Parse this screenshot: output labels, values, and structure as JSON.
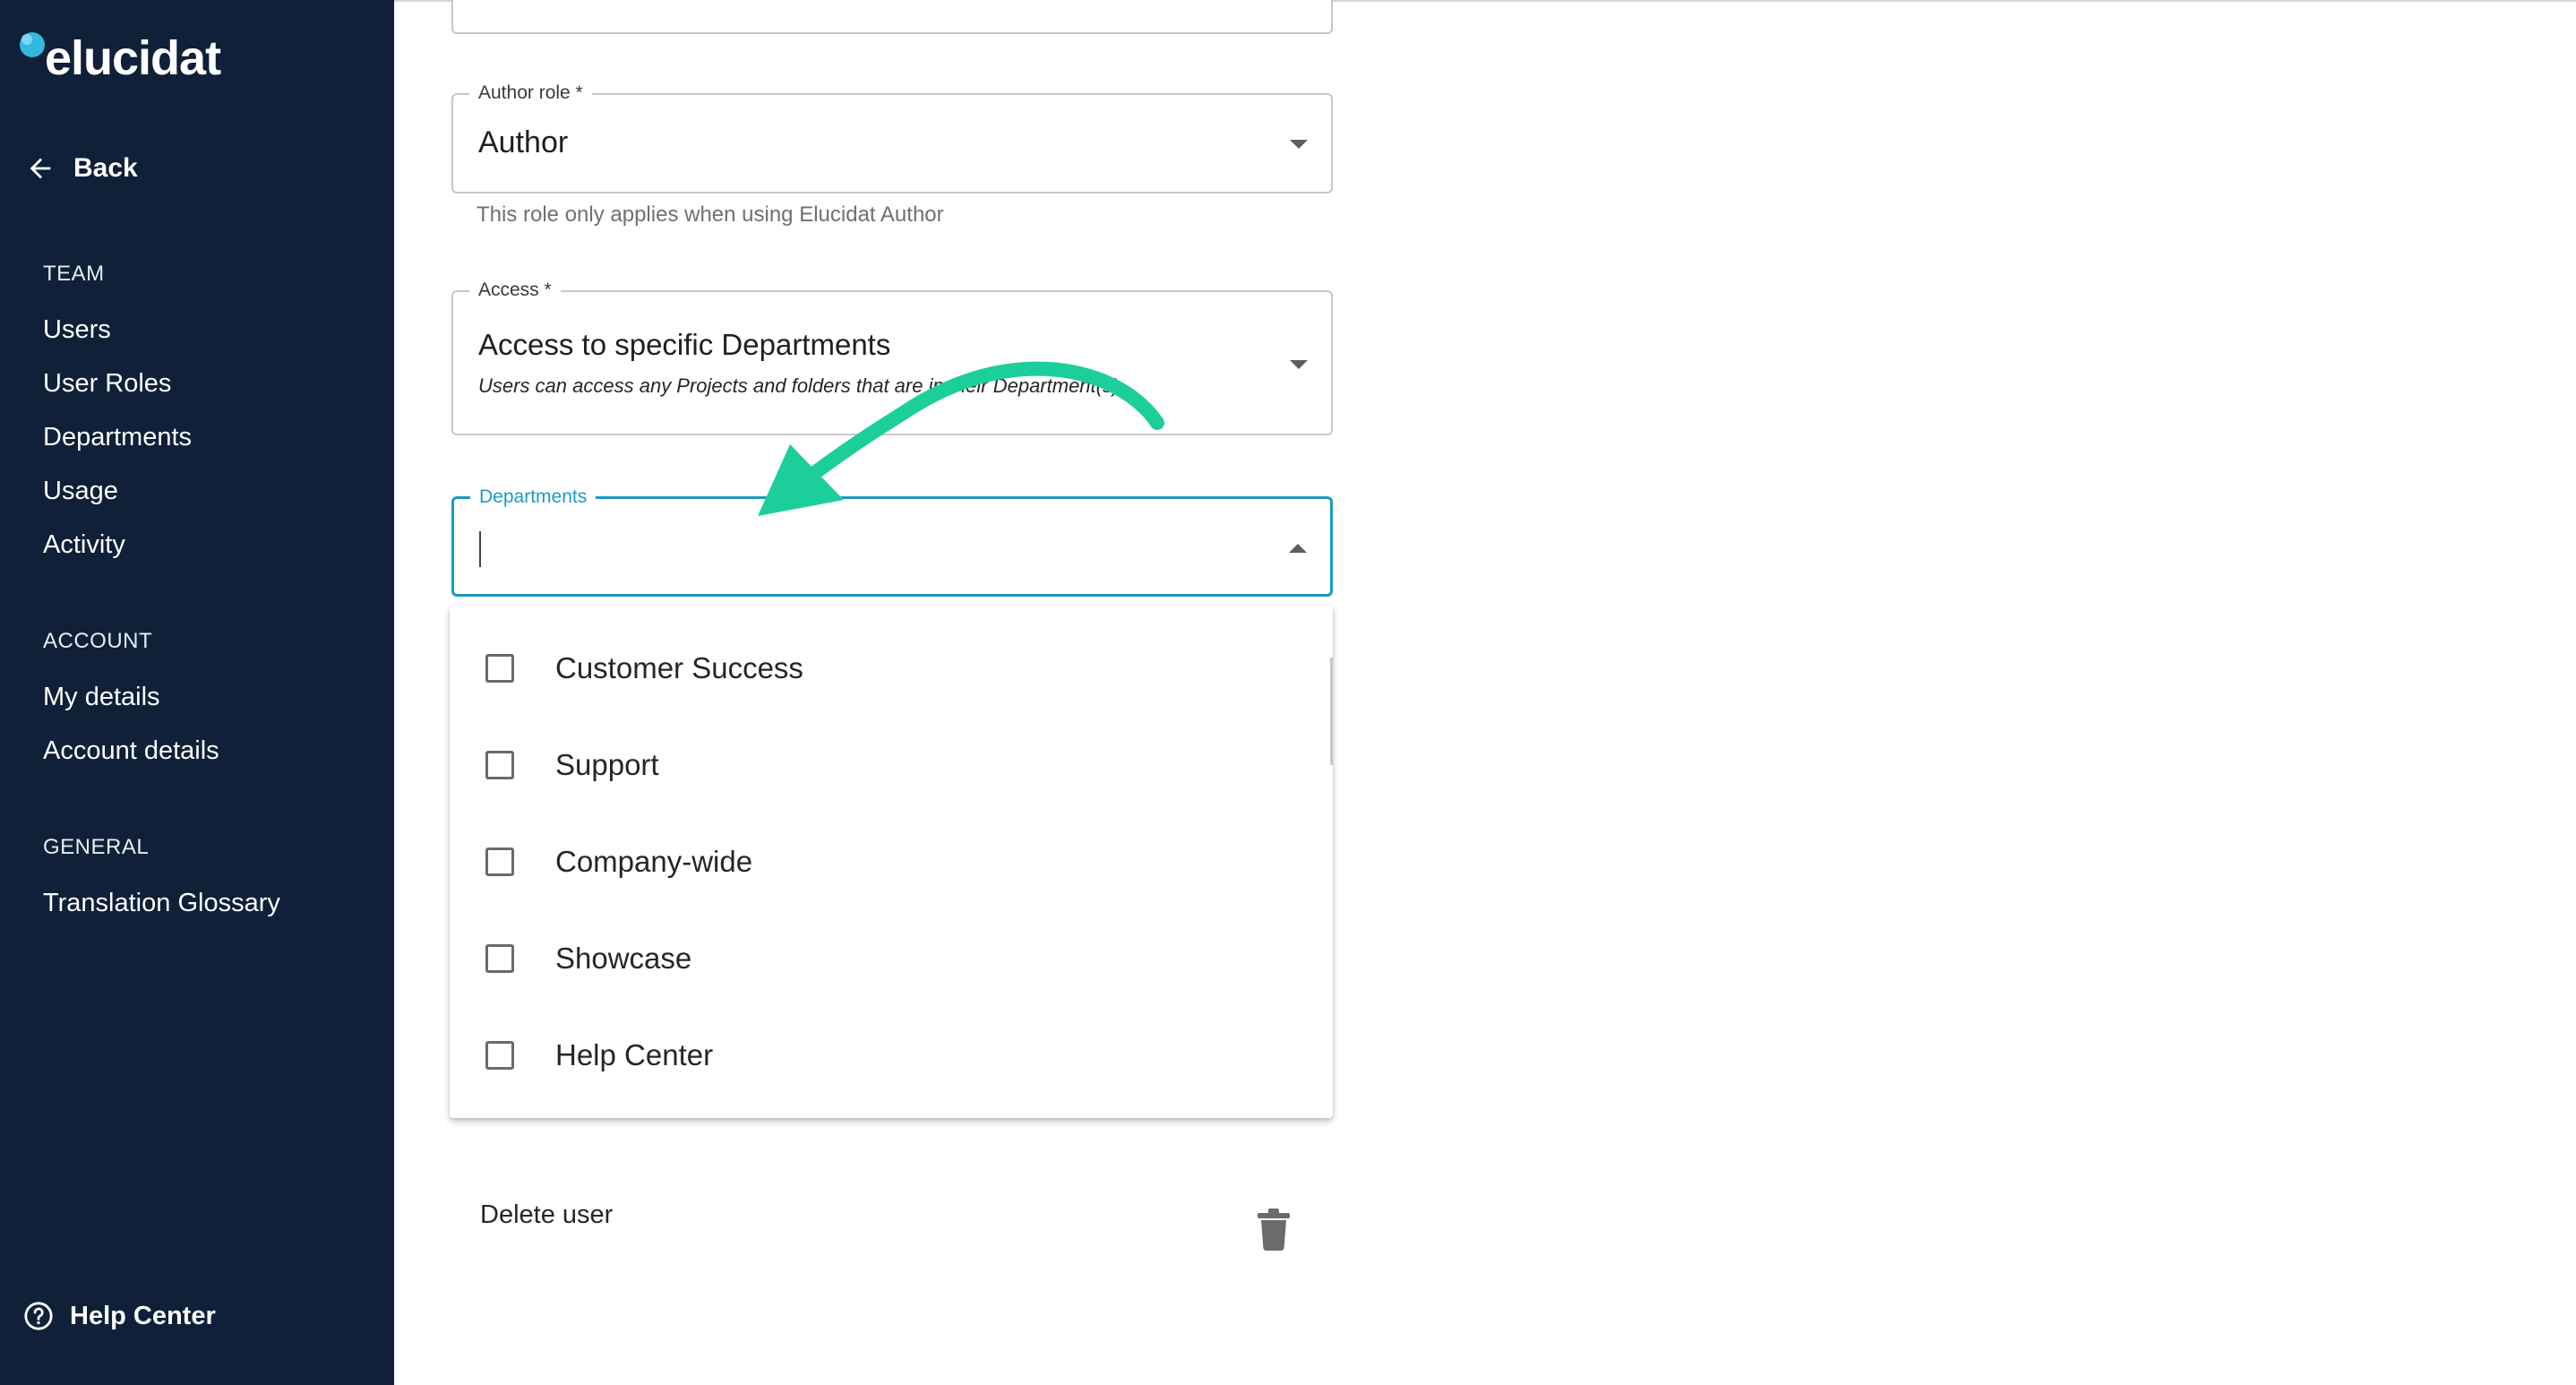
{
  "app": {
    "brand": "elucidat"
  },
  "sidebar": {
    "back_label": "Back",
    "sections": [
      {
        "title": "TEAM",
        "items": [
          "Users",
          "User Roles",
          "Departments",
          "Usage",
          "Activity"
        ]
      },
      {
        "title": "ACCOUNT",
        "items": [
          "My details",
          "Account details"
        ]
      },
      {
        "title": "GENERAL",
        "items": [
          "Translation Glossary"
        ]
      }
    ],
    "help_label": "Help Center"
  },
  "form": {
    "author_role": {
      "label": "Author role *",
      "value": "Author",
      "helper": "This role only applies when using Elucidat Author"
    },
    "access": {
      "label": "Access *",
      "value": "Access to specific Departments",
      "description": "Users can access any Projects and folders that are in their Department(s)."
    },
    "departments": {
      "label": "Departments",
      "value": "",
      "options": [
        "Customer Success",
        "Support",
        "Company-wide",
        "Showcase",
        "Help Center"
      ]
    },
    "delete_label": "Delete user"
  },
  "colors": {
    "sidebar_bg": "#0f2038",
    "accent": "#1a9bc4",
    "annotation_arrow": "#1ccf9a",
    "logo_dot": "#35b8e0"
  },
  "icons": {
    "back": "arrow-left-icon",
    "help": "question-circle-icon",
    "delete": "trash-icon",
    "dropdown": "caret-down-icon"
  }
}
